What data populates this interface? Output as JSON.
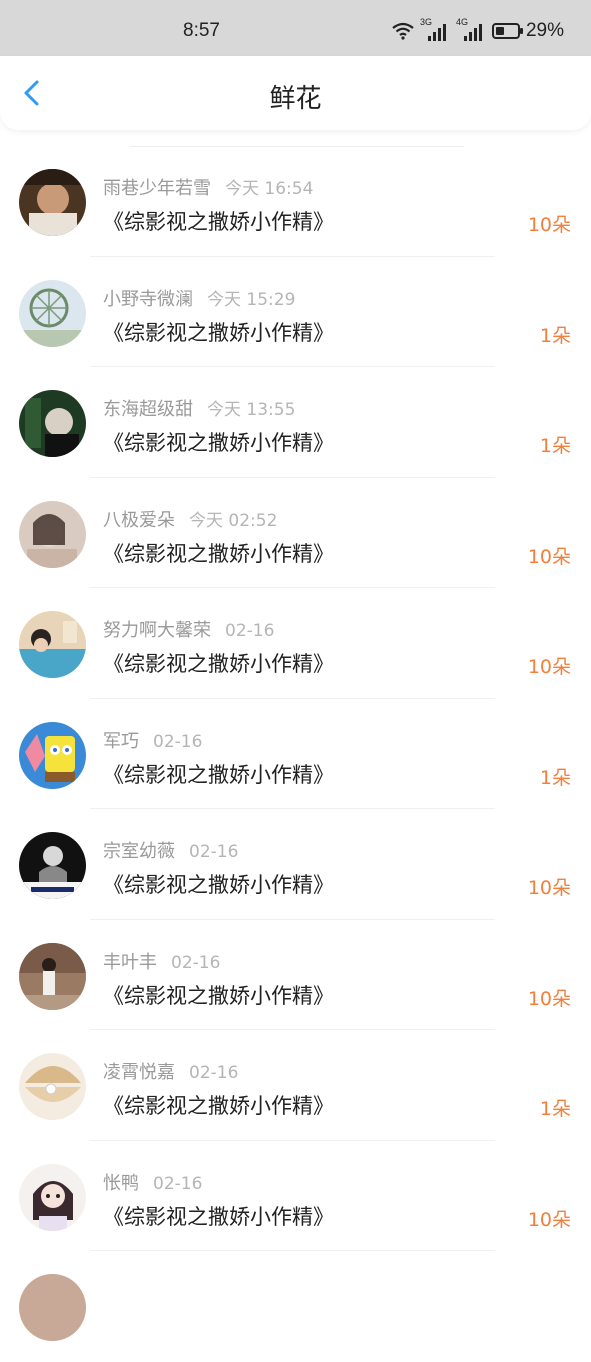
{
  "status": {
    "time": "8:57",
    "battery": "29%",
    "net1": "3G",
    "net2": "4G"
  },
  "header": {
    "title": "鲜花"
  },
  "colors": {
    "accent": "#2d9cf2",
    "count": "#f0803c",
    "name": "#9a9a9a"
  },
  "items": [
    {
      "name": "雨巷少年若雪",
      "time": "今天 16:54",
      "book": "《综影视之撒娇小作精》",
      "count": "10朵"
    },
    {
      "name": "小野寺微澜",
      "time": "今天 15:29",
      "book": "《综影视之撒娇小作精》",
      "count": "1朵"
    },
    {
      "name": "东海超级甜",
      "time": "今天 13:55",
      "book": "《综影视之撒娇小作精》",
      "count": "1朵"
    },
    {
      "name": "八极爱朵",
      "time": "今天 02:52",
      "book": "《综影视之撒娇小作精》",
      "count": "10朵"
    },
    {
      "name": "努力啊大馨荣",
      "time": "02-16",
      "book": "《综影视之撒娇小作精》",
      "count": "10朵"
    },
    {
      "name": "军巧",
      "time": "02-16",
      "book": "《综影视之撒娇小作精》",
      "count": "1朵"
    },
    {
      "name": "宗室幼薇",
      "time": "02-16",
      "book": "《综影视之撒娇小作精》",
      "count": "10朵"
    },
    {
      "name": "丰叶丰",
      "time": "02-16",
      "book": "《综影视之撒娇小作精》",
      "count": "10朵"
    },
    {
      "name": "凌霄悦嘉",
      "time": "02-16",
      "book": "《综影视之撒娇小作精》",
      "count": "1朵"
    },
    {
      "name": "怅鸭",
      "time": "02-16",
      "book": "《综影视之撒娇小作精》",
      "count": "10朵"
    }
  ]
}
